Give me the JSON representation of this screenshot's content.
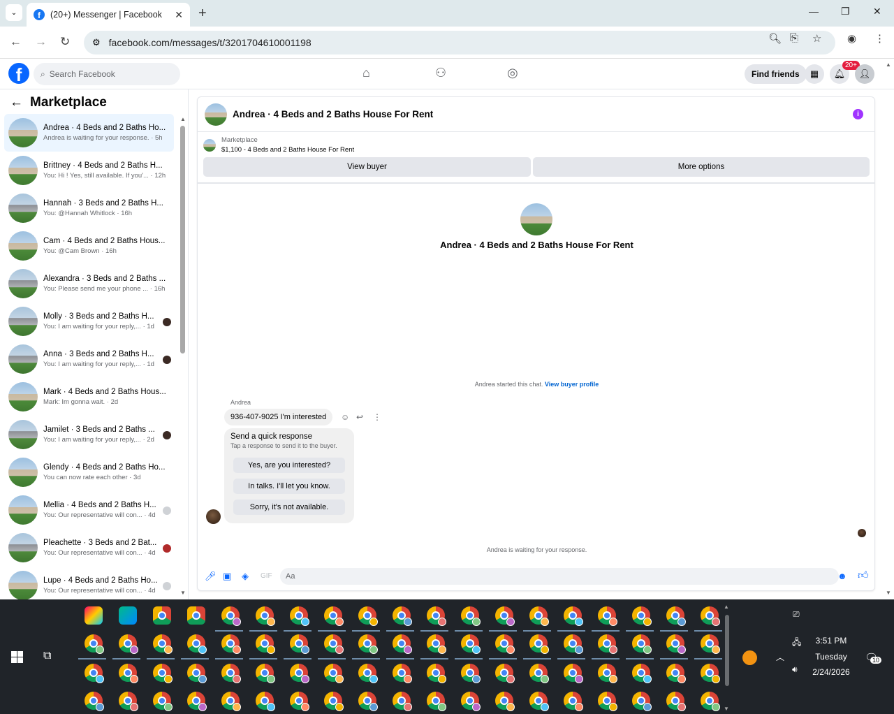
{
  "browser": {
    "tab_title": "(20+) Messenger | Facebook",
    "url": "facebook.com/messages/t/3201704610001198"
  },
  "fb_header": {
    "search_placeholder": "Search Facebook",
    "find_friends": "Find friends",
    "notifications_count": "20+"
  },
  "sidebar": {
    "title": "Marketplace",
    "conversations": [
      {
        "name": "Andrea · 4 Beds and 2 Baths Ho...",
        "preview": "Andrea is waiting for your response. · 5h",
        "thumb": "beige",
        "indicator": ""
      },
      {
        "name": "Brittney · 4 Beds and 2 Baths H...",
        "preview": "You: Hi ! Yes, still available. If you'... · 12h",
        "thumb": "beige",
        "indicator": ""
      },
      {
        "name": "Hannah · 3 Beds and 2 Baths H...",
        "preview": "You: @Hannah Whitlock · 16h",
        "thumb": "gray",
        "indicator": ""
      },
      {
        "name": "Cam · 4 Beds and 2 Baths Hous...",
        "preview": "You: @Cam Brown · 16h",
        "thumb": "beige",
        "indicator": ""
      },
      {
        "name": "Alexandra · 3 Beds and 2 Baths ...",
        "preview": "You: Please send me your phone ... · 16h",
        "thumb": "gray",
        "indicator": ""
      },
      {
        "name": "Molly · 3 Beds and 2 Baths H...",
        "preview": "You: I am waiting for your reply,... · 1d",
        "thumb": "gray",
        "indicator": "dark"
      },
      {
        "name": "Anna · 3 Beds and 2 Baths H...",
        "preview": "You: I am waiting for your reply,... · 1d",
        "thumb": "gray",
        "indicator": "dark"
      },
      {
        "name": "Mark · 4 Beds and 2 Baths Hous...",
        "preview": "Mark: Im gonna wait. · 2d",
        "thumb": "beige",
        "indicator": ""
      },
      {
        "name": "Jamilet · 3 Beds and 2 Baths ...",
        "preview": "You: I am waiting for your reply,... · 2d",
        "thumb": "gray",
        "indicator": "dark"
      },
      {
        "name": "Glendy · 4 Beds and 2 Baths Ho...",
        "preview": "You can now rate each other · 3d",
        "thumb": "beige",
        "indicator": ""
      },
      {
        "name": "Mellia · 4 Beds and 2 Baths H...",
        "preview": "You: Our representative will con... · 4d",
        "thumb": "beige",
        "indicator": "light"
      },
      {
        "name": "Pleachette · 3 Beds and 2 Bat...",
        "preview": "You: Our representative will con... · 4d",
        "thumb": "gray",
        "indicator": "red"
      },
      {
        "name": "Lupe · 4 Beds and 2 Baths Ho...",
        "preview": "You: Our representative will con... · 4d",
        "thumb": "beige",
        "indicator": "light"
      }
    ]
  },
  "chat": {
    "title": "Andrea · 4 Beds and 2 Baths House For Rent",
    "marketplace_label": "Marketplace",
    "listing": "$1,100 - 4 Beds and 2 Baths House For Rent",
    "view_buyer": "View buyer",
    "more_options": "More options",
    "center_title": "Andrea · 4 Beds and 2 Baths House For Rent",
    "started_text": "Andrea started this chat.",
    "view_buyer_profile": "View buyer profile",
    "sender_name": "Andrea",
    "message": "936-407-9025 I'm interested",
    "quick_title": "Send a quick response",
    "quick_sub": "Tap a response to send it to the buyer.",
    "quick_options": [
      "Yes, are you interested?",
      "In talks. I'll let you know.",
      "Sorry, it's not available."
    ],
    "waiting_text": "Andrea is waiting for your response.",
    "composer_placeholder": "Aa"
  },
  "taskbar": {
    "time": "3:51 PM",
    "day": "Tuesday",
    "date": "2/24/2026",
    "notification_count": "10"
  }
}
